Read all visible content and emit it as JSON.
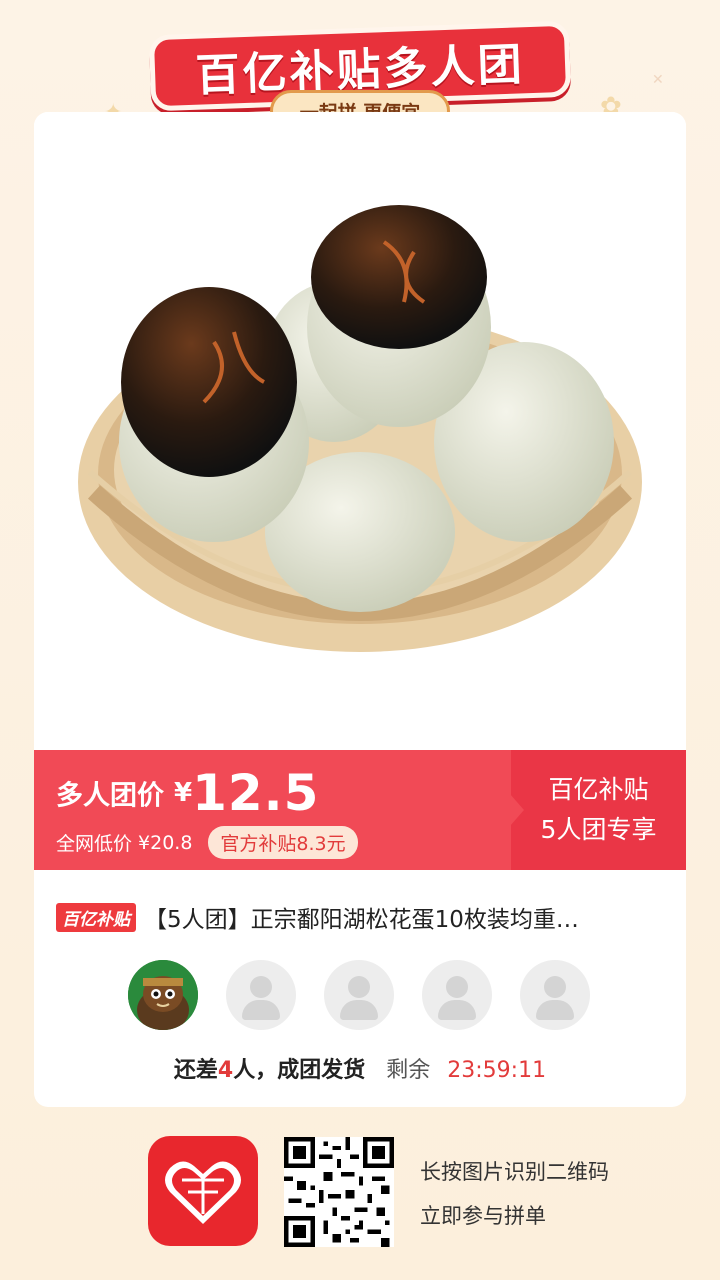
{
  "banner": {
    "title": "百亿补贴多人团",
    "subtitle": "一起拼 更便宜"
  },
  "price_bar": {
    "label": "多人团价",
    "currency": "¥",
    "price": "12.5",
    "orig_label": "全网低价",
    "orig_price": "¥20.8",
    "subsidy": "官方补贴8.3元",
    "right_line1": "百亿补贴",
    "right_line2": "5人团专享"
  },
  "product": {
    "tag": "百亿补贴",
    "title": "【5人团】正宗鄱阳湖松花蛋10枚装均重…"
  },
  "group": {
    "status_prefix": "还差",
    "missing_count": "4",
    "status_suffix": "人，成团发货",
    "remain_label": "剩余",
    "countdown": "23:59:11",
    "slots_total": 5,
    "slots_filled": 1
  },
  "footer": {
    "line1": "长按图片识别二维码",
    "line2": "立即参与拼单"
  },
  "colors": {
    "brand_red": "#e8313b",
    "price_bar": "#f14a56",
    "background": "#fdf3e6"
  }
}
